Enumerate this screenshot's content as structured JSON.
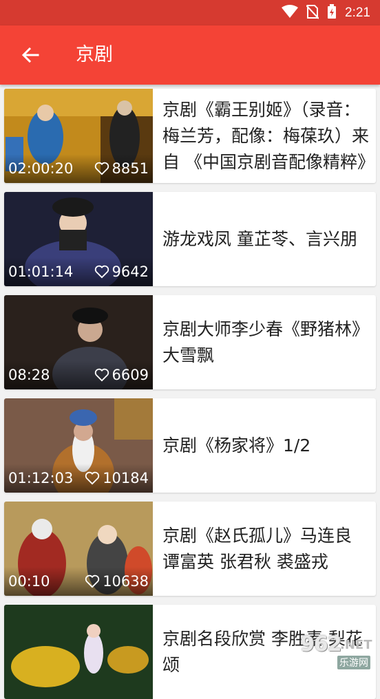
{
  "status_bar": {
    "time": "2:21"
  },
  "app_bar": {
    "title": "京剧"
  },
  "videos": [
    {
      "duration": "02:00:20",
      "likes": "8851",
      "title": "京剧《霸王别姬》（录音：梅兰芳，配像：梅葆玖）来自 《中国京剧音配像精粹》",
      "thumb_color": "#c28a1c"
    },
    {
      "duration": "01:01:14",
      "likes": "9642",
      "title": "游龙戏凤 童芷苓、言兴朋",
      "thumb_color": "#2b2d4a"
    },
    {
      "duration": "08:28",
      "likes": "6609",
      "title": "京剧大师李少春《野猪林》大雪飘",
      "thumb_color": "#3a2e28"
    },
    {
      "duration": "01:12:03",
      "likes": "10184",
      "title": "京剧《杨家将》1/2",
      "thumb_color": "#7a5a48"
    },
    {
      "duration": "00:10",
      "likes": "10638",
      "title": "京剧《赵氏孤儿》马连良 谭富英 张君秋 裘盛戎",
      "thumb_color": "#b89a5c"
    },
    {
      "duration": "",
      "likes": "",
      "title": "京剧名段欣赏 李胜素 梨花颂",
      "thumb_color": "#2a4a2a"
    }
  ],
  "watermark": {
    "number": "962",
    "suffix": ".NET",
    "sub": "乐游网"
  }
}
